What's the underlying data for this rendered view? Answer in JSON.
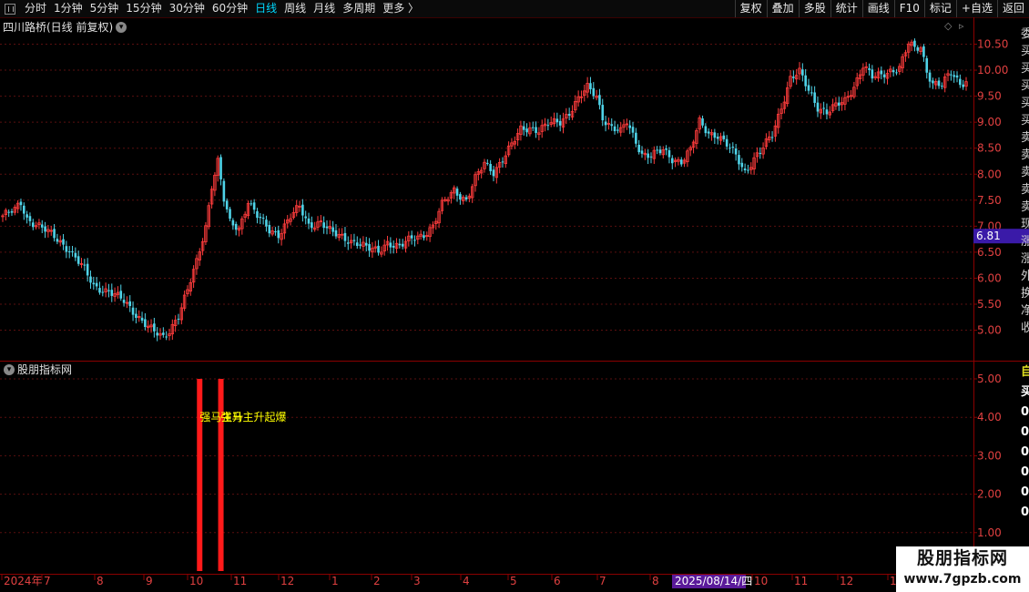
{
  "toolbar": {
    "periods": [
      "分时",
      "1分钟",
      "5分钟",
      "15分钟",
      "30分钟",
      "60分钟",
      "日线",
      "周线",
      "月线",
      "多周期",
      "更多"
    ],
    "active_period": "日线",
    "more_arrow": "〉",
    "buttons": [
      "复权",
      "叠加",
      "多股",
      "统计",
      "画线",
      "F10",
      "标记",
      "+自选",
      "返回"
    ]
  },
  "main_panel": {
    "title": "四川路桥(日线 前复权)",
    "current_price_label": "6.81",
    "right_edge_chars": [
      "委",
      "买",
      "买",
      "买",
      "买",
      "买",
      "卖",
      "卖",
      "卖",
      "卖",
      "卖",
      "现",
      "涨",
      "涨",
      "外",
      "换",
      "净",
      "收"
    ]
  },
  "indicator_panel": {
    "title": "股朋指标网",
    "signal_text": "强马主升",
    "signal_overlap_text": "强马主升起爆",
    "right_edge_chars": [
      "自",
      "买",
      "0",
      "0",
      "0",
      "0",
      "0",
      "0"
    ]
  },
  "date_highlight": "2025/08/14/四",
  "watermark": {
    "line1": "股朋指标网",
    "line2": "www.7gpzb.com"
  },
  "colors": {
    "up": "#ff3c3c",
    "down": "#4fd3e8",
    "grid": "#5a0f0f",
    "axis": "#8b0000",
    "signal_bar": "#ff1a1a",
    "signal_text": "#ffff00",
    "price_badge": "#3a1aa8",
    "date_badge": "#5a1a9a"
  },
  "chart_data": [
    {
      "type": "candlestick",
      "title": "四川路桥(日线 前复权)",
      "yticks": [
        5.0,
        5.5,
        6.0,
        6.5,
        7.0,
        7.5,
        8.0,
        8.5,
        9.0,
        9.5,
        10.0,
        10.5
      ],
      "ylim": [
        4.6,
        10.75
      ],
      "x_tick_labels": [
        "2024年",
        "7",
        "8",
        "9",
        "10",
        "11",
        "12",
        "1",
        "2",
        "3",
        "4",
        "5",
        "6",
        "7",
        "8",
        "9",
        "10",
        "11",
        "12",
        "1"
      ],
      "current_price": 6.81,
      "anchors": [
        [
          0,
          7.2
        ],
        [
          4,
          7.3
        ],
        [
          6,
          7.45
        ],
        [
          8,
          7.15
        ],
        [
          12,
          7.0
        ],
        [
          18,
          6.75
        ],
        [
          22,
          6.55
        ],
        [
          27,
          6.15
        ],
        [
          30,
          5.85
        ],
        [
          35,
          5.75
        ],
        [
          40,
          5.55
        ],
        [
          45,
          5.25
        ],
        [
          50,
          4.95
        ],
        [
          53,
          4.85
        ],
        [
          55,
          5.0
        ],
        [
          58,
          5.3
        ],
        [
          61,
          5.75
        ],
        [
          64,
          6.3
        ],
        [
          67,
          7.0
        ],
        [
          69,
          7.8
        ],
        [
          71,
          8.25
        ],
        [
          73,
          7.5
        ],
        [
          75,
          7.05
        ],
        [
          78,
          6.95
        ],
        [
          81,
          7.5
        ],
        [
          84,
          7.2
        ],
        [
          88,
          6.9
        ],
        [
          91,
          6.85
        ],
        [
          95,
          7.2
        ],
        [
          98,
          7.35
        ],
        [
          101,
          7.0
        ],
        [
          105,
          7.1
        ],
        [
          109,
          6.85
        ],
        [
          113,
          6.75
        ],
        [
          117,
          6.7
        ],
        [
          121,
          6.55
        ],
        [
          124,
          6.5
        ],
        [
          127,
          6.7
        ],
        [
          131,
          6.6
        ],
        [
          135,
          6.75
        ],
        [
          139,
          6.85
        ],
        [
          142,
          7.0
        ],
        [
          145,
          7.4
        ],
        [
          149,
          7.7
        ],
        [
          153,
          7.5
        ],
        [
          156,
          7.9
        ],
        [
          159,
          8.2
        ],
        [
          162,
          8.05
        ],
        [
          165,
          8.3
        ],
        [
          168,
          8.55
        ],
        [
          171,
          8.85
        ],
        [
          174,
          8.9
        ],
        [
          177,
          8.85
        ],
        [
          180,
          8.95
        ],
        [
          184,
          9.0
        ],
        [
          187,
          9.2
        ],
        [
          190,
          9.45
        ],
        [
          193,
          9.65
        ],
        [
          196,
          9.5
        ],
        [
          198,
          9.1
        ],
        [
          201,
          8.9
        ],
        [
          204,
          8.8
        ],
        [
          206,
          9.0
        ],
        [
          208,
          8.75
        ],
        [
          211,
          8.4
        ],
        [
          214,
          8.35
        ],
        [
          218,
          8.45
        ],
        [
          221,
          8.3
        ],
        [
          224,
          8.25
        ],
        [
          227,
          8.45
        ],
        [
          230,
          9.0
        ],
        [
          233,
          8.8
        ],
        [
          236,
          8.75
        ],
        [
          239,
          8.55
        ],
        [
          242,
          8.35
        ],
        [
          245,
          8.05
        ],
        [
          248,
          8.3
        ],
        [
          251,
          8.5
        ],
        [
          254,
          8.75
        ],
        [
          257,
          9.3
        ],
        [
          260,
          9.85
        ],
        [
          263,
          9.95
        ],
        [
          266,
          9.6
        ],
        [
          269,
          9.3
        ],
        [
          272,
          9.2
        ],
        [
          275,
          9.3
        ],
        [
          278,
          9.4
        ],
        [
          281,
          9.7
        ],
        [
          284,
          10.1
        ],
        [
          287,
          9.85
        ],
        [
          290,
          9.9
        ],
        [
          293,
          10.0
        ],
        [
          296,
          10.05
        ],
        [
          299,
          10.5
        ],
        [
          301,
          10.4
        ],
        [
          303,
          10.45
        ],
        [
          305,
          10.0
        ],
        [
          307,
          9.75
        ],
        [
          310,
          9.7
        ],
        [
          313,
          9.95
        ],
        [
          316,
          9.75
        ],
        [
          318,
          9.8
        ]
      ]
    },
    {
      "type": "bar",
      "title": "股朋指标网",
      "yticks": [
        1.0,
        2.0,
        3.0,
        4.0,
        5.0
      ],
      "ylim": [
        0,
        5.25
      ],
      "signals": [
        {
          "bar_index": 65,
          "value": 5,
          "label": "强马主升"
        },
        {
          "bar_index": 72,
          "value": 5,
          "label": "强马主升起爆"
        }
      ]
    }
  ]
}
